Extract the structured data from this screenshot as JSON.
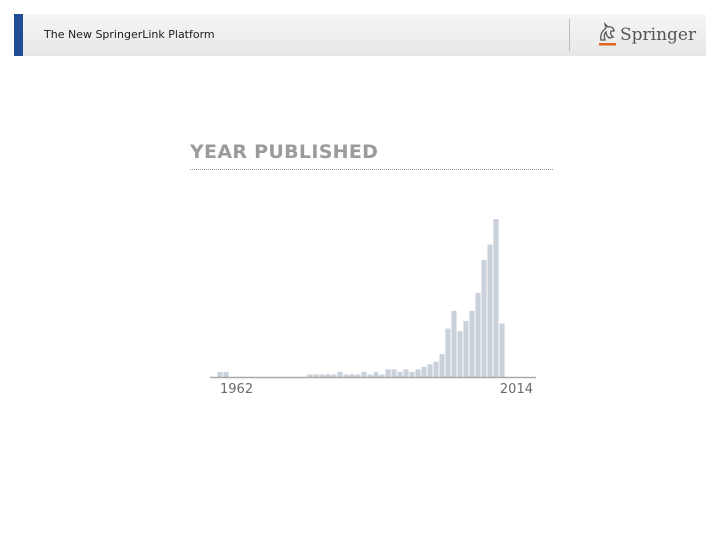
{
  "header": {
    "title": "The New SpringerLink Platform",
    "brand": "Springer",
    "accent_color": "#1f4e96"
  },
  "chart_data": {
    "type": "bar",
    "title": "YEAR PUBLISHED",
    "x": [
      1962,
      1963,
      1977,
      1978,
      1979,
      1980,
      1981,
      1982,
      1983,
      1984,
      1985,
      1986,
      1987,
      1988,
      1989,
      1990,
      1991,
      1992,
      1993,
      1994,
      1995,
      1996,
      1997,
      1998,
      1999,
      2000,
      2001,
      2002,
      2003,
      2004,
      2005,
      2006,
      2007,
      2008,
      2009,
      2010,
      2011,
      2012,
      2013,
      2014
    ],
    "values": [
      2,
      2,
      1,
      1,
      1,
      1,
      1,
      2,
      1,
      1,
      1,
      2,
      1,
      2,
      1,
      3,
      3,
      2,
      3,
      2,
      3,
      4,
      5,
      6,
      9,
      19,
      26,
      18,
      22,
      26,
      33,
      46,
      52,
      62,
      21
    ],
    "tick_labels": [
      "1962",
      "2014"
    ],
    "ylim": [
      0,
      64
    ],
    "bar_color": "#c9d1da",
    "baseline_color": "#a9a9a9",
    "grid": false
  }
}
